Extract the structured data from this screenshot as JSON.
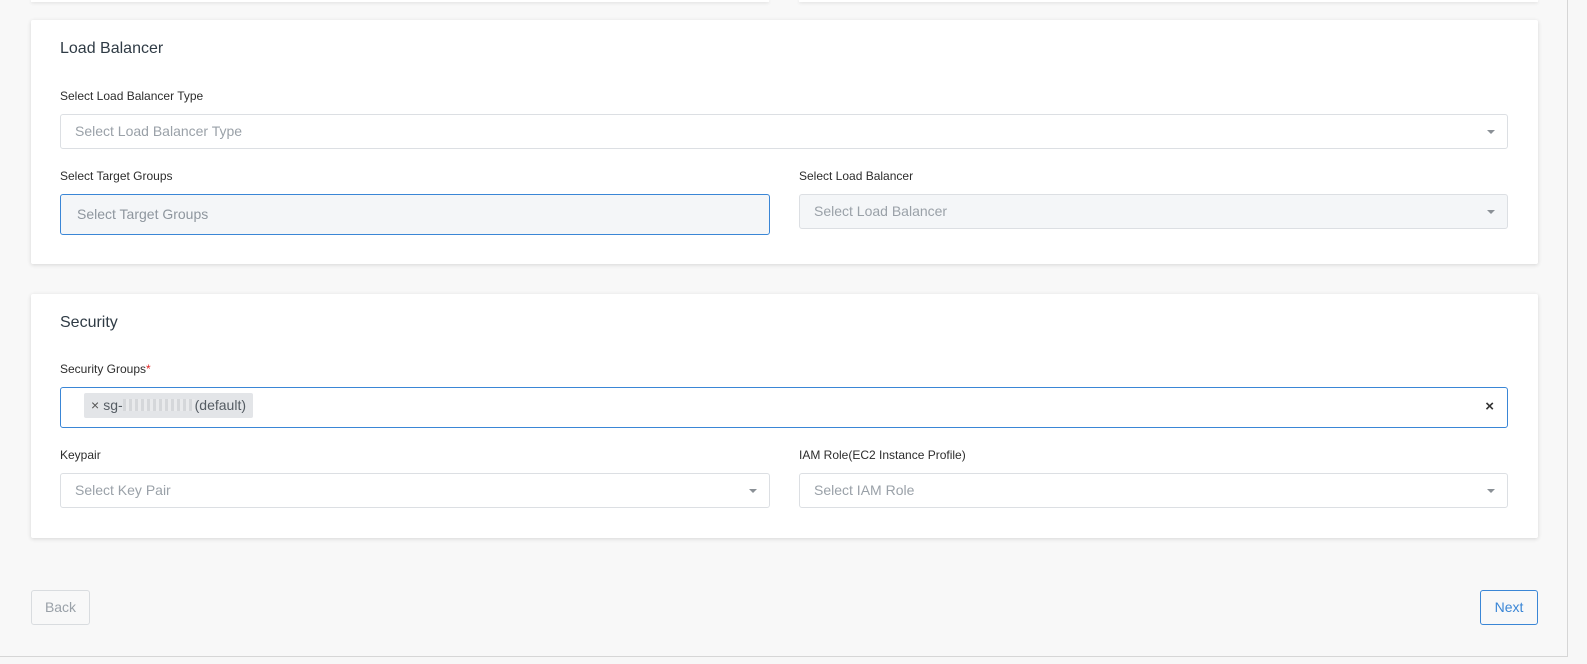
{
  "load_balancer": {
    "title": "Load Balancer",
    "type_label": "Select Load Balancer Type",
    "type_placeholder": "Select Load Balancer Type",
    "target_groups_label": "Select Target Groups",
    "target_groups_placeholder": "Select Target Groups",
    "lb_label": "Select Load Balancer",
    "lb_placeholder": "Select Load Balancer"
  },
  "security": {
    "title": "Security",
    "groups_label": "Security Groups",
    "required_mark": "*",
    "selected_tag": {
      "remove": "×",
      "prefix": "sg-",
      "suffix": "(default)"
    },
    "clear_all": "×",
    "keypair_label": "Keypair",
    "keypair_placeholder": "Select Key Pair",
    "iam_label": "IAM Role(EC2 Instance Profile)",
    "iam_placeholder": "Select IAM Role"
  },
  "footer": {
    "back_label": "Back",
    "next_label": "Next"
  },
  "icons": {
    "caret": "chevron-down-icon",
    "remove": "close-icon"
  },
  "colors": {
    "accent": "#3a86d6",
    "required": "#e02424"
  }
}
